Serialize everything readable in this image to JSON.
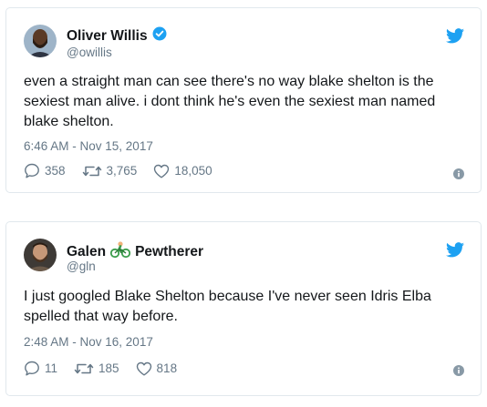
{
  "tweets": [
    {
      "name": "Oliver Willis",
      "handle": "@owillis",
      "verified": true,
      "text": "even a straight man can see there's no way blake shelton is the sexiest man alive. i dont think he's even the sexiest man named blake shelton.",
      "timestamp": "6:46 AM - Nov 15, 2017",
      "replies": "358",
      "retweets": "3,765",
      "likes": "18,050"
    },
    {
      "name_first": "Galen",
      "name_last": "Pewtherer",
      "name_emoji": "bicycle-icon",
      "handle": "@gln",
      "text": "I just googled Blake Shelton because I've never seen Idris Elba spelled that way before.",
      "timestamp": "2:48 AM - Nov 16, 2017",
      "replies": "11",
      "retweets": "185",
      "likes": "818"
    }
  ],
  "icons": {
    "brand": "twitter-bird-icon",
    "reply": "reply-icon",
    "retweet": "retweet-icon",
    "like": "heart-icon",
    "info": "info-icon"
  },
  "colors": {
    "brand_blue": "#1da1f2",
    "muted": "#657786",
    "text": "#14171a",
    "border": "#e1e8ed"
  }
}
